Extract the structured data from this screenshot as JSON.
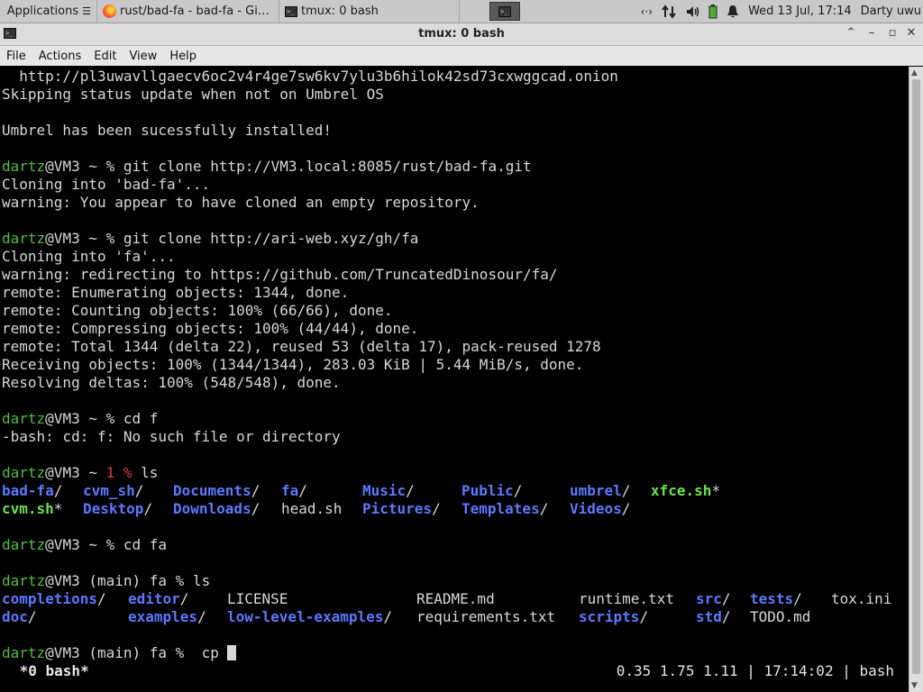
{
  "panel": {
    "apps_label": "Applications",
    "firefox_task": "rust/bad-fa - bad-fa - Gi…",
    "tmux_task": "tmux: 0 bash",
    "clock": "Wed 13 Jul, 17:14",
    "user": "Darty uwu",
    "icons": [
      "xfce-logo-icon",
      "firefox-icon",
      "terminal-icon",
      "network-arrows-icon",
      "updown-icon",
      "volume-icon",
      "battery-icon",
      "bell-icon"
    ]
  },
  "window": {
    "title": "tmux: 0 bash",
    "menu": [
      "File",
      "Actions",
      "Edit",
      "View",
      "Help"
    ]
  },
  "terminal": {
    "prompt_user": "dartz",
    "prompt_host": "@VM3",
    "lines": {
      "l0": "  http://pl3uwavllgaecv6oc2v4r4ge7sw6kv7ylu3b6hilok42sd73cxwggcad.onion",
      "l1": "Skipping status update when not on Umbrel OS",
      "l3": "Umbrel has been sucessfully installed!",
      "l5_cmd": " ~ % git clone http://VM3.local:8085/rust/bad-fa.git",
      "l6": "Cloning into 'bad-fa'...",
      "l7": "warning: You appear to have cloned an empty repository.",
      "l9_cmd": " ~ % git clone http://ari-web.xyz/gh/fa",
      "l10": "Cloning into 'fa'...",
      "l11": "warning: redirecting to https://github.com/TruncatedDinosour/fa/",
      "l12": "remote: Enumerating objects: 1344, done.",
      "l13": "remote: Counting objects: 100% (66/66), done.",
      "l14": "remote: Compressing objects: 100% (44/44), done.",
      "l15": "remote: Total 1344 (delta 22), reused 53 (delta 17), pack-reused 1278",
      "l16": "Receiving objects: 100% (1344/1344), 283.03 KiB | 5.44 MiB/s, done.",
      "l17": "Resolving deltas: 100% (548/548), done.",
      "l19_cmd": " ~ % cd f",
      "l20": "-bash: cd: f: No such file or directory",
      "l22_pre": " ~ ",
      "l22_err": "1 %",
      "l22_cmd": " ls",
      "l27_cmd": " ~ % cd fa",
      "l29_cmd": " (main) fa % ls",
      "l33_cmd": " (main) fa %  cp "
    },
    "ls_home": {
      "row1": [
        {
          "t": "bad-fa",
          "k": "dir",
          "s": "/"
        },
        {
          "t": "cvm_sh",
          "k": "dir",
          "s": "/"
        },
        {
          "t": "Documents",
          "k": "dir",
          "s": "/"
        },
        {
          "t": "fa",
          "k": "dir",
          "s": "/"
        },
        {
          "t": "Music",
          "k": "dir",
          "s": "/"
        },
        {
          "t": "Public",
          "k": "dir",
          "s": "/"
        },
        {
          "t": "umbrel",
          "k": "dir",
          "s": "/"
        },
        {
          "t": "xfce.sh",
          "k": "ex",
          "s": "*"
        }
      ],
      "row2": [
        {
          "t": "cvm.sh",
          "k": "ex",
          "s": "*"
        },
        {
          "t": "Desktop",
          "k": "dir",
          "s": "/"
        },
        {
          "t": "Downloads",
          "k": "dir",
          "s": "/"
        },
        {
          "t": "head.sh",
          "k": "file",
          "s": ""
        },
        {
          "t": "Pictures",
          "k": "dir",
          "s": "/"
        },
        {
          "t": "Templates",
          "k": "dir",
          "s": "/"
        },
        {
          "t": "Videos",
          "k": "dir",
          "s": "/"
        }
      ]
    },
    "ls_fa": {
      "row1": [
        {
          "t": "completions",
          "k": "dir",
          "s": "/"
        },
        {
          "t": "editor",
          "k": "dir",
          "s": "/"
        },
        {
          "t": "LICENSE",
          "k": "file",
          "s": ""
        },
        {
          "t": "README.md",
          "k": "file",
          "s": ""
        },
        {
          "t": "runtime.txt",
          "k": "file",
          "s": ""
        },
        {
          "t": "src",
          "k": "dir",
          "s": "/"
        },
        {
          "t": "tests",
          "k": "dir",
          "s": "/"
        },
        {
          "t": "tox.ini",
          "k": "file",
          "s": ""
        }
      ],
      "row2": [
        {
          "t": "doc",
          "k": "dir",
          "s": "/"
        },
        {
          "t": "examples",
          "k": "dir",
          "s": "/"
        },
        {
          "t": "low-level-examples",
          "k": "dir",
          "s": "/"
        },
        {
          "t": "requirements.txt",
          "k": "file",
          "s": ""
        },
        {
          "t": "scripts",
          "k": "dir",
          "s": "/"
        },
        {
          "t": "std",
          "k": "dir",
          "s": "/"
        },
        {
          "t": "TODO.md",
          "k": "file",
          "s": ""
        }
      ]
    }
  },
  "status": {
    "left": " *0 bash*",
    "right": "0.35 1.75 1.11 | 17:14:02 | bash"
  },
  "colors": {
    "prompt_green": "#4fbf3a",
    "dir_blue": "#5b79ff",
    "exec_green": "#6be34a",
    "error_red": "#e03a3a"
  }
}
